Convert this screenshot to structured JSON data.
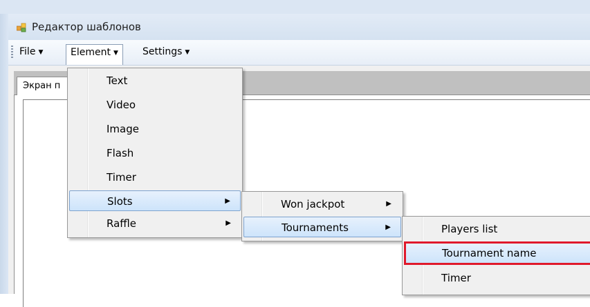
{
  "window": {
    "title": "Редактор шаблонов",
    "icon": "app-window-icon"
  },
  "menubar": {
    "items": [
      {
        "label": "File"
      },
      {
        "label": "Element"
      },
      {
        "label": "Settings"
      }
    ],
    "arrow": "▼"
  },
  "tabs": [
    {
      "label": "Экран п"
    }
  ],
  "element_menu": {
    "items": [
      {
        "label": "Text"
      },
      {
        "label": "Video"
      },
      {
        "label": "Image"
      },
      {
        "label": "Flash"
      },
      {
        "label": "Timer"
      },
      {
        "label": "Slots",
        "submenu": true,
        "highlighted": true
      },
      {
        "label": "Raffle",
        "submenu": true
      }
    ]
  },
  "slots_menu": {
    "items": [
      {
        "label": "Won jackpot",
        "submenu": true
      },
      {
        "label": "Tournaments",
        "submenu": true,
        "highlighted": true
      }
    ]
  },
  "tournaments_menu": {
    "items": [
      {
        "label": "Players list"
      },
      {
        "label": "Tournament name",
        "highlighted": true,
        "annotated": true
      },
      {
        "label": "Timer"
      }
    ]
  },
  "submenu_arrow": "▶",
  "colors": {
    "highlight_border": "#7da2ce",
    "annotation": "#e0192b"
  }
}
